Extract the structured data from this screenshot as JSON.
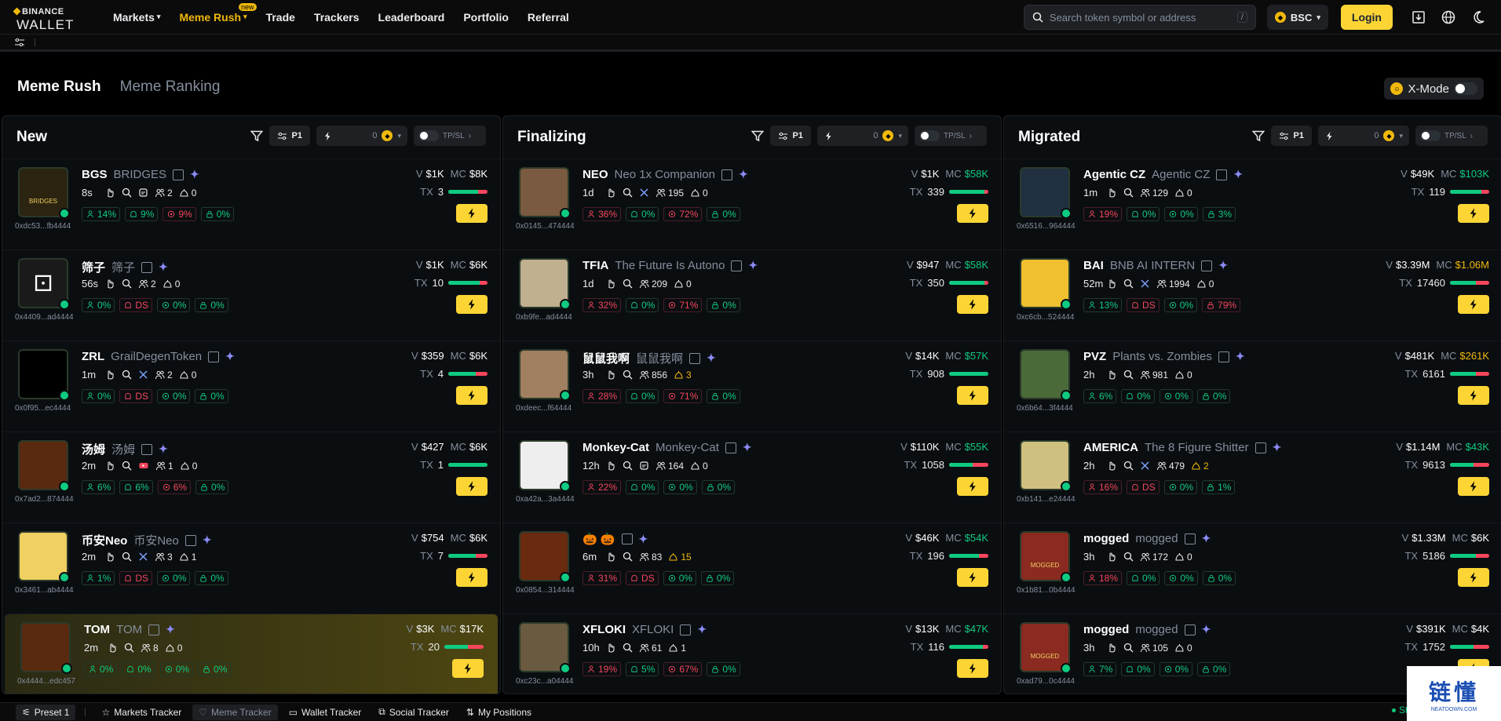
{
  "brand": {
    "line1": "BINANCE",
    "line2": "WALLET"
  },
  "nav": [
    {
      "label": "Markets",
      "caret": true
    },
    {
      "label": "Meme Rush",
      "caret": true,
      "active": true,
      "badge": "new"
    },
    {
      "label": "Trade"
    },
    {
      "label": "Trackers"
    },
    {
      "label": "Leaderboard"
    },
    {
      "label": "Portfolio"
    },
    {
      "label": "Referral"
    }
  ],
  "search": {
    "placeholder": "Search token symbol or address",
    "shortcut": "/"
  },
  "chain": "BSC",
  "login": "Login",
  "tabs": [
    {
      "label": "Meme Rush",
      "active": true
    },
    {
      "label": "Meme Ranking",
      "active": false
    }
  ],
  "xmode": "X-Mode",
  "columns": [
    {
      "title": "New",
      "preset": "P1",
      "quick": "0",
      "tpsl": "TP/SL",
      "tokens": [
        {
          "sym": "BGS",
          "name": "BRIDGES",
          "age": "8s",
          "addr": "0xdc53...fb4444",
          "extra": "web",
          "holders": "2",
          "snipers": "0",
          "pills": [
            "14%",
            "9%",
            "9%",
            "0%"
          ],
          "pillred": [
            false,
            false,
            true,
            false
          ],
          "v": "$1K",
          "mc": "$8K",
          "mcc": "w",
          "tx": "3",
          "ratio": 0.75,
          "av": "#2b2410",
          "avc": "BRIDGES"
        },
        {
          "sym": "筛子",
          "name": "筛子",
          "age": "56s",
          "addr": "0x4409...ad4444",
          "extra": "",
          "holders": "2",
          "snipers": "0",
          "pills": [
            "0%",
            "DS",
            "0%",
            "0%"
          ],
          "pillred": [
            false,
            true,
            false,
            false
          ],
          "v": "$1K",
          "mc": "$6K",
          "mcc": "w",
          "tx": "10",
          "ratio": 0.8,
          "av": "#1a1a1a",
          "avc": "dice"
        },
        {
          "sym": "ZRL",
          "name": "GrailDegenToken",
          "age": "1m",
          "addr": "0x0f95...ec4444",
          "extra": "x",
          "holders": "2",
          "snipers": "0",
          "pills": [
            "0%",
            "DS",
            "0%",
            "0%"
          ],
          "pillred": [
            false,
            true,
            false,
            false
          ],
          "v": "$359",
          "mc": "$6K",
          "mcc": "w",
          "tx": "4",
          "ratio": 0.7,
          "av": "#000",
          "avc": ""
        },
        {
          "sym": "汤姆",
          "name": "汤姆",
          "age": "2m",
          "addr": "0x7ad2...874444",
          "extra": "yt",
          "holders": "1",
          "snipers": "0",
          "pills": [
            "6%",
            "6%",
            "6%",
            "0%"
          ],
          "pillred": [
            false,
            false,
            true,
            false
          ],
          "v": "$427",
          "mc": "$6K",
          "mcc": "w",
          "tx": "1",
          "ratio": 1,
          "av": "#5a2a10",
          "avc": ""
        },
        {
          "sym": "币安Neo",
          "name": "币安Neo",
          "age": "2m",
          "addr": "0x3461...ab4444",
          "extra": "x",
          "holders": "3",
          "snipers": "1",
          "pills": [
            "1%",
            "DS",
            "0%",
            "0%"
          ],
          "pillred": [
            false,
            true,
            false,
            false
          ],
          "v": "$754",
          "mc": "$6K",
          "mcc": "w",
          "tx": "7",
          "ratio": 0.7,
          "av": "#f0d060",
          "avc": ""
        },
        {
          "sym": "TOM",
          "name": "TOM",
          "age": "2m",
          "addr": "0x4444...edc457",
          "extra": "",
          "holders": "8",
          "snipers": "0",
          "pills": [
            "0%",
            "0%",
            "0%",
            "0%"
          ],
          "pillred": [
            false,
            false,
            false,
            false
          ],
          "v": "$3K",
          "mc": "$17K",
          "mcc": "w",
          "tx": "20",
          "ratio": 0.6,
          "av": "#5a2a10",
          "avc": "",
          "hl": true
        }
      ]
    },
    {
      "title": "Finalizing",
      "preset": "P1",
      "quick": "0",
      "tpsl": "TP/SL",
      "tokens": [
        {
          "sym": "NEO",
          "name": "Neo 1x Companion",
          "age": "1d",
          "addr": "0x0145...474444",
          "extra": "x",
          "holders": "195",
          "snipers": "0",
          "pills": [
            "36%",
            "0%",
            "72%",
            "0%"
          ],
          "pillred": [
            true,
            false,
            true,
            false
          ],
          "v": "$1K",
          "mc": "$58K",
          "mcc": "g",
          "tx": "339",
          "ratio": 0.9,
          "av": "#7a5a40",
          "avc": ""
        },
        {
          "sym": "TFIA",
          "name": "The Future Is Autono",
          "age": "1d",
          "addr": "0xb9fe...ad4444",
          "extra": "",
          "holders": "209",
          "snipers": "0",
          "pills": [
            "32%",
            "0%",
            "71%",
            "0%"
          ],
          "pillred": [
            true,
            false,
            true,
            false
          ],
          "v": "$947",
          "mc": "$58K",
          "mcc": "g",
          "tx": "350",
          "ratio": 0.9,
          "av": "#c0b090",
          "avc": ""
        },
        {
          "sym": "鼠鼠我啊",
          "name": "鼠鼠我啊",
          "age": "3h",
          "addr": "0xdeec...f64444",
          "extra": "",
          "holders": "856",
          "snipers": "3",
          "snipewarn": true,
          "pills": [
            "28%",
            "0%",
            "71%",
            "0%"
          ],
          "pillred": [
            true,
            false,
            true,
            false
          ],
          "v": "$14K",
          "mc": "$57K",
          "mcc": "g",
          "tx": "908",
          "ratio": 1,
          "av": "#a08060",
          "avc": ""
        },
        {
          "sym": "Monkey-Cat",
          "name": "Monkey-Cat",
          "age": "12h",
          "addr": "0xa42a...3a4444",
          "extra": "web",
          "holders": "164",
          "snipers": "0",
          "pills": [
            "22%",
            "0%",
            "0%",
            "0%"
          ],
          "pillred": [
            true,
            false,
            false,
            false
          ],
          "v": "$110K",
          "mc": "$55K",
          "mcc": "g",
          "tx": "1058",
          "ratio": 0.6,
          "av": "#eee",
          "avc": ""
        },
        {
          "sym": "🎃 🎃",
          "name": "",
          "age": "6m",
          "addr": "0x0854...314444",
          "extra": "",
          "holders": "83",
          "snipers": "15",
          "snipewarn": true,
          "pills": [
            "31%",
            "DS",
            "0%",
            "0%"
          ],
          "pillred": [
            true,
            true,
            false,
            false
          ],
          "v": "$46K",
          "mc": "$54K",
          "mcc": "g",
          "tx": "196",
          "ratio": 0.75,
          "av": "#6a2a10",
          "avc": ""
        },
        {
          "sym": "XFLOKI",
          "name": "XFLOKI",
          "age": "10h",
          "addr": "0xc23c...a04444",
          "extra": "",
          "holders": "61",
          "snipers": "1",
          "pills": [
            "19%",
            "5%",
            "67%",
            "0%"
          ],
          "pillred": [
            true,
            false,
            true,
            false
          ],
          "v": "$13K",
          "mc": "$47K",
          "mcc": "g",
          "tx": "116",
          "ratio": 0.85,
          "av": "#6a5a40",
          "avc": ""
        }
      ]
    },
    {
      "title": "Migrated",
      "preset": "P1",
      "quick": "0",
      "tpsl": "TP/SL",
      "tokens": [
        {
          "sym": "Agentic CZ",
          "name": "Agentic CZ",
          "age": "1m",
          "addr": "0x6516...964444",
          "extra": "",
          "holders": "129",
          "snipers": "0",
          "pills": [
            "19%",
            "0%",
            "0%",
            "3%"
          ],
          "pillred": [
            true,
            false,
            false,
            false
          ],
          "v": "$49K",
          "mc": "$103K",
          "mcc": "g",
          "tx": "119",
          "ratio": 0.8,
          "av": "#203040",
          "avc": ""
        },
        {
          "sym": "BAI",
          "name": "BNB AI INTERN",
          "age": "52m",
          "addr": "0xc6cb...524444",
          "extra": "x",
          "holders": "1994",
          "snipers": "0",
          "pills": [
            "13%",
            "DS",
            "0%",
            "79%"
          ],
          "pillred": [
            false,
            true,
            false,
            true
          ],
          "v": "$3.39M",
          "mc": "$1.06M",
          "mcc": "y",
          "tx": "17460",
          "ratio": 0.65,
          "av": "#f0c030",
          "avc": ""
        },
        {
          "sym": "PVZ",
          "name": "Plants vs. Zombies",
          "age": "2h",
          "addr": "0x6b64...3f4444",
          "extra": "",
          "holders": "981",
          "snipers": "0",
          "pills": [
            "6%",
            "0%",
            "0%",
            "0%"
          ],
          "pillred": [
            false,
            false,
            false,
            false
          ],
          "v": "$481K",
          "mc": "$261K",
          "mcc": "y",
          "tx": "6161",
          "ratio": 0.65,
          "av": "#4a6a3a",
          "avc": ""
        },
        {
          "sym": "AMERICA",
          "name": "The 8 Figure Shitter",
          "age": "2h",
          "addr": "0xb141...e24444",
          "extra": "x",
          "holders": "479",
          "snipers": "2",
          "snipewarn": true,
          "pills": [
            "16%",
            "DS",
            "0%",
            "1%"
          ],
          "pillred": [
            true,
            true,
            false,
            false
          ],
          "v": "$1.14M",
          "mc": "$43K",
          "mcc": "g",
          "tx": "9613",
          "ratio": 0.6,
          "av": "#d0c080",
          "avc": ""
        },
        {
          "sym": "mogged",
          "name": "mogged",
          "age": "3h",
          "addr": "0x1b81...0b4444",
          "extra": "",
          "holders": "172",
          "snipers": "0",
          "pills": [
            "18%",
            "0%",
            "0%",
            "0%"
          ],
          "pillred": [
            true,
            false,
            false,
            false
          ],
          "v": "$1.33M",
          "mc": "$6K",
          "mcc": "w",
          "tx": "5186",
          "ratio": 0.65,
          "av": "#8a2a20",
          "avc": "MOGGED"
        },
        {
          "sym": "mogged",
          "name": "mogged",
          "age": "3h",
          "addr": "0xad79...0c4444",
          "extra": "",
          "holders": "105",
          "snipers": "0",
          "pills": [
            "7%",
            "0%",
            "0%",
            "0%"
          ],
          "pillred": [
            false,
            false,
            false,
            false
          ],
          "v": "$391K",
          "mc": "$4K",
          "mcc": "w",
          "tx": "1752",
          "ratio": 0.6,
          "av": "#8a2a20",
          "avc": "MOGGED"
        }
      ]
    }
  ],
  "footer": [
    {
      "label": "Preset 1",
      "active": true
    },
    {
      "label": "Markets Tracker"
    },
    {
      "label": "Meme Tracker",
      "dim": true
    },
    {
      "label": "Wallet Tracker"
    },
    {
      "label": "Social Tracker"
    },
    {
      "label": "My Positions"
    }
  ],
  "stable": "Stable",
  "watermark": {
    "title": "链懂",
    "sub": "NEATDOWN.COM"
  },
  "labels": {
    "v": "V",
    "mc": "MC",
    "tx": "TX"
  }
}
